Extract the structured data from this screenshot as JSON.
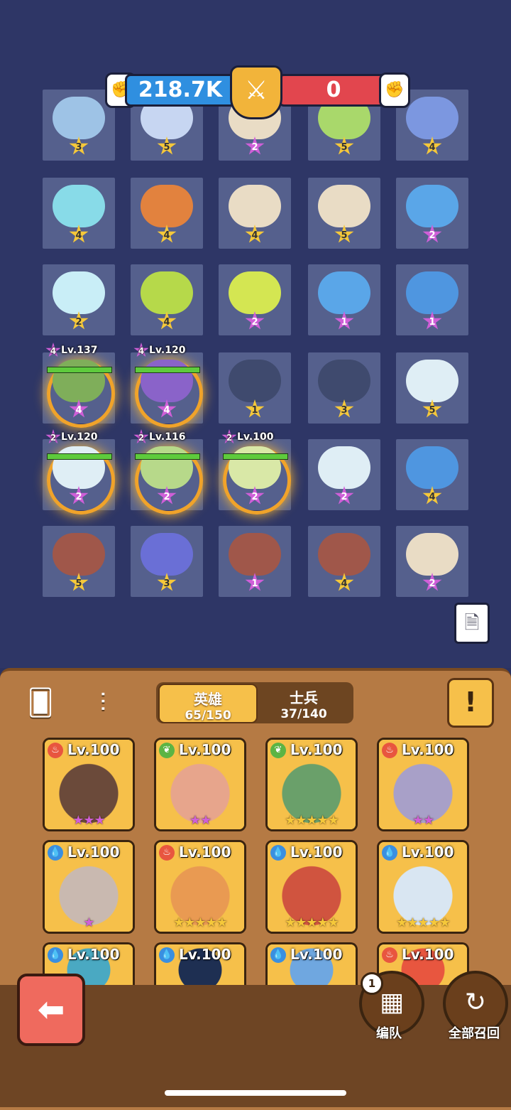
{
  "battle": {
    "left_power": "218.7K",
    "right_power": "0"
  },
  "grid": [
    {
      "stars": "3",
      "star_color": "gold",
      "unit": "#9ec3e6"
    },
    {
      "stars": "5",
      "star_color": "gold",
      "unit": "#c7d6f2"
    },
    {
      "stars": "2",
      "star_color": "pink",
      "unit": "#e9dcc5"
    },
    {
      "stars": "5",
      "star_color": "gold",
      "unit": "#a9d86b"
    },
    {
      "stars": "4",
      "star_color": "gold",
      "unit": "#7c97e0"
    },
    {
      "stars": "4",
      "star_color": "gold",
      "unit": "#88dbe8"
    },
    {
      "stars": "4",
      "star_color": "gold",
      "unit": "#e2823e"
    },
    {
      "stars": "4",
      "star_color": "gold",
      "unit": "#e9dcc5"
    },
    {
      "stars": "5",
      "star_color": "gold",
      "unit": "#e9dcc5"
    },
    {
      "stars": "2",
      "star_color": "pink",
      "unit": "#5aa6e8"
    },
    {
      "stars": "2",
      "star_color": "gold",
      "unit": "#c9eef7"
    },
    {
      "stars": "4",
      "star_color": "gold",
      "unit": "#b6d94a"
    },
    {
      "stars": "2",
      "star_color": "pink",
      "unit": "#d4e652"
    },
    {
      "stars": "1",
      "star_color": "pink",
      "unit": "#5aa6e8"
    },
    {
      "stars": "1",
      "star_color": "pink",
      "unit": "#4f96e0"
    },
    {
      "stars": "4",
      "star_color": "pink",
      "unit": "#7fae5a",
      "hero": true,
      "hero_stars": "4",
      "level": "Lv.137"
    },
    {
      "stars": "4",
      "star_color": "pink",
      "unit": "#8a63c9",
      "hero": true,
      "hero_stars": "4",
      "level": "Lv.120"
    },
    {
      "stars": "1",
      "star_color": "gold",
      "unit": "#3f4a6e"
    },
    {
      "stars": "3",
      "star_color": "gold",
      "unit": "#3f4a6e"
    },
    {
      "stars": "5",
      "star_color": "gold",
      "unit": "#dfeef5"
    },
    {
      "stars": "2",
      "star_color": "pink",
      "unit": "#dfeef5",
      "hero": true,
      "hero_stars": "2",
      "level": "Lv.120"
    },
    {
      "stars": "2",
      "star_color": "pink",
      "unit": "#b7d98a",
      "hero": true,
      "hero_stars": "2",
      "level": "Lv.116"
    },
    {
      "stars": "2",
      "star_color": "pink",
      "unit": "#d9e8a7",
      "hero": true,
      "hero_stars": "2",
      "level": "Lv.100"
    },
    {
      "stars": "2",
      "star_color": "pink",
      "unit": "#dfeef5"
    },
    {
      "stars": "4",
      "star_color": "gold",
      "unit": "#4f96e0"
    },
    {
      "stars": "5",
      "star_color": "gold",
      "unit": "#a0574a"
    },
    {
      "stars": "3",
      "star_color": "gold",
      "unit": "#6a6fd6"
    },
    {
      "stars": "1",
      "star_color": "pink",
      "unit": "#a0574a"
    },
    {
      "stars": "4",
      "star_color": "gold",
      "unit": "#a0574a"
    },
    {
      "stars": "2",
      "star_color": "pink",
      "unit": "#e9dcc5"
    }
  ],
  "tabs": {
    "heroes_label": "英雄",
    "heroes_count": "65/150",
    "soldiers_label": "士兵",
    "soldiers_count": "37/140"
  },
  "info_button": "!",
  "cards": [
    {
      "level": "Lv.100",
      "element": "fire",
      "stars": "★★★",
      "star_color": "#cf5fd8",
      "face": "#6b4a3a"
    },
    {
      "level": "Lv.100",
      "element": "leaf",
      "stars": "★★",
      "star_color": "#cf5fd8",
      "face": "#e7a58c"
    },
    {
      "level": "Lv.100",
      "element": "leaf",
      "stars": "★★★★★",
      "star_color": "#f5c83a",
      "face": "#6aa06a"
    },
    {
      "level": "Lv.100",
      "element": "fire",
      "stars": "★★",
      "star_color": "#cf5fd8",
      "face": "#a8a0c8"
    },
    {
      "level": "Lv.100",
      "element": "water",
      "stars": "★",
      "star_color": "#cf5fd8",
      "face": "#c9b9b0"
    },
    {
      "level": "Lv.100",
      "element": "fire",
      "stars": "★★★★★",
      "star_color": "#f5c83a",
      "face": "#e99a52"
    },
    {
      "level": "Lv.100",
      "element": "water",
      "stars": "★★★★★",
      "star_color": "#f5c83a",
      "face": "#d0543f"
    },
    {
      "level": "Lv.100",
      "element": "water",
      "stars": "★★★★★",
      "star_color": "#f5c83a",
      "face": "#d9e6f2"
    },
    {
      "level": "Lv.100",
      "element": "water",
      "stars": "",
      "star_color": "#f5c83a",
      "face": "#4aa9c2"
    },
    {
      "level": "Lv.100",
      "element": "water",
      "stars": "",
      "star_color": "#f5c83a",
      "face": "#1e2f52"
    },
    {
      "level": "Lv.100",
      "element": "water",
      "stars": "",
      "star_color": "#f5c83a",
      "face": "#6fa7e0"
    },
    {
      "level": "Lv.100",
      "element": "fire",
      "stars": "",
      "star_color": "#f5c83a",
      "face": "#e8563f"
    }
  ],
  "element_colors": {
    "fire": "#e8563f",
    "leaf": "#5cb444",
    "water": "#3a8fe0"
  },
  "element_glyph": {
    "fire": "♨",
    "leaf": "❦",
    "water": "💧"
  },
  "buttons": {
    "team_label": "编队",
    "team_badge": "1",
    "recall_label": "全部召回"
  }
}
